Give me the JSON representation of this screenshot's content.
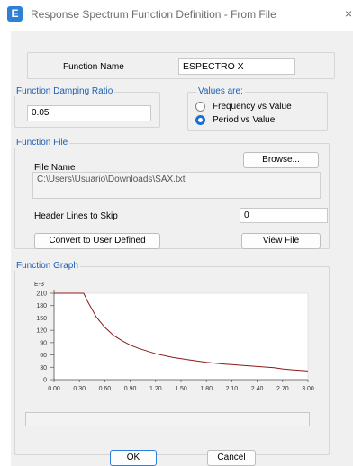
{
  "window": {
    "icon_letter": "E",
    "title": "Response Spectrum Function Definition - From File",
    "close_glyph": "×"
  },
  "function_name": {
    "label": "Function Name",
    "value": "ESPECTRO X"
  },
  "damping": {
    "group_label": "Function Damping Ratio",
    "value": "0.05"
  },
  "values_are": {
    "group_label": "Values are:",
    "options": [
      {
        "label": "Frequency vs Value",
        "selected": false
      },
      {
        "label": "Period vs Value",
        "selected": true
      }
    ]
  },
  "function_file": {
    "group_label": "Function File",
    "file_name_label": "File Name",
    "browse_label": "Browse...",
    "path": "C:\\Users\\Usuario\\Downloads\\SAX.txt",
    "header_lines_label": "Header Lines to Skip",
    "header_lines_value": "0",
    "convert_label": "Convert to User Defined",
    "view_label": "View File"
  },
  "graph": {
    "group_label": "Function Graph"
  },
  "chart_data": {
    "type": "line",
    "multiplier_label": "E-3",
    "xlim": [
      0,
      3
    ],
    "ylim": [
      0,
      210
    ],
    "xticks": [
      "0.00",
      "0.30",
      "0.60",
      "0.90",
      "1.20",
      "1.50",
      "1.80",
      "2.10",
      "2.40",
      "2.70",
      "3.00"
    ],
    "yticks": [
      "210",
      "180",
      "150",
      "120",
      "90",
      "60",
      "30",
      "0"
    ],
    "ytick_values": [
      210,
      180,
      150,
      120,
      90,
      60,
      30,
      0
    ],
    "line_color": "#8b1a1a",
    "x": [
      0.0,
      0.1,
      0.2,
      0.3,
      0.35,
      0.4,
      0.5,
      0.6,
      0.7,
      0.8,
      0.9,
      1.0,
      1.2,
      1.4,
      1.6,
      1.8,
      2.0,
      2.2,
      2.4,
      2.6,
      2.7,
      2.8,
      3.0
    ],
    "y": [
      210,
      210,
      210,
      210,
      210,
      189,
      152,
      127,
      108,
      95,
      84,
      76,
      63,
      54,
      48,
      42,
      38,
      35,
      32,
      29,
      26,
      24,
      21
    ]
  },
  "buttons": {
    "ok": "OK",
    "cancel": "Cancel"
  }
}
